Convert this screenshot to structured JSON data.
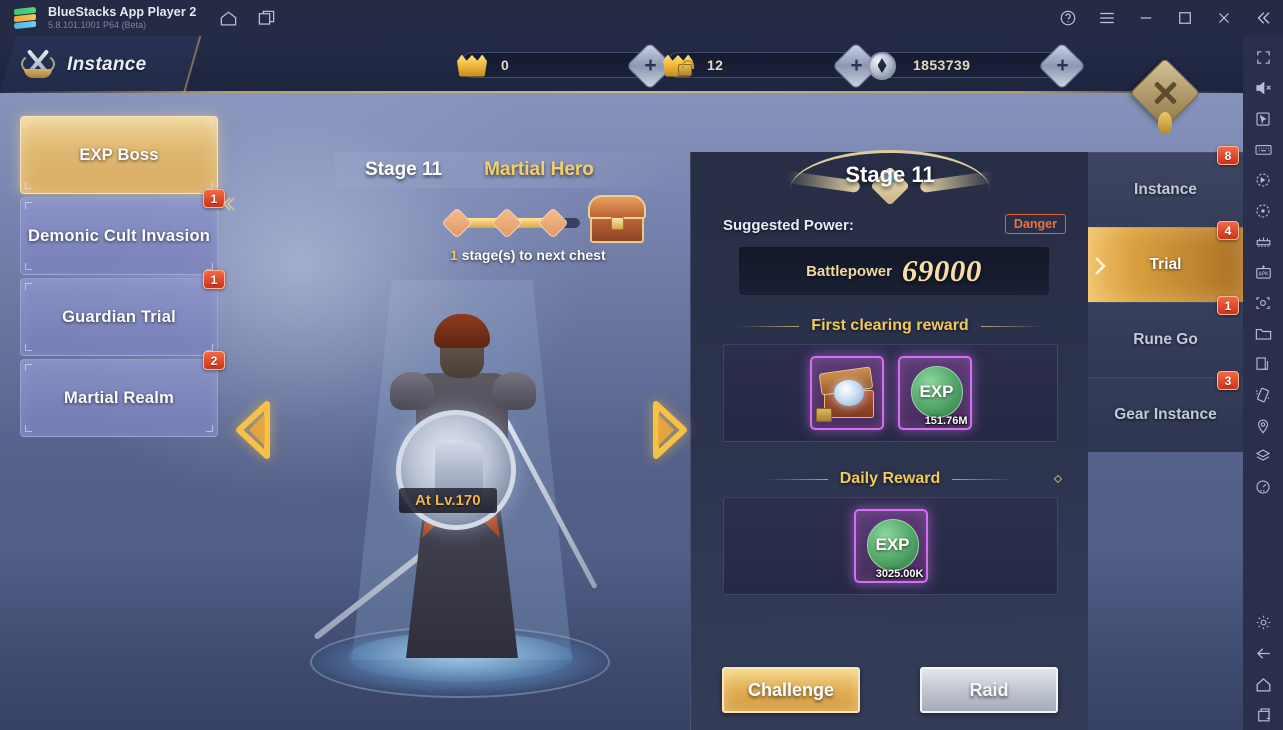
{
  "titlebar": {
    "app_name": "BlueStacks App Player 2",
    "version": "5.8.101.1001 P64 (Beta)",
    "icons": [
      "home-icon",
      "multi-instance-icon"
    ],
    "controls": [
      "help-icon",
      "menu-icon",
      "minimize-icon",
      "maximize-icon",
      "close-icon",
      "collapse-icon"
    ]
  },
  "game": {
    "header": {
      "title": "Instance",
      "currencies": [
        {
          "icon": "gold-ingot-icon",
          "value": "0"
        },
        {
          "icon": "locked-gold-ingot-icon",
          "value": "12"
        },
        {
          "icon": "silver-gem-icon",
          "value": "1853739"
        }
      ],
      "add_label": "+",
      "close_label": "close-diamond-button"
    },
    "left_menu": [
      {
        "label": "EXP Boss",
        "badge": "",
        "selected": true
      },
      {
        "label": "Demonic Cult Invasion",
        "badge": "1",
        "selected": false
      },
      {
        "label": "Guardian Trial",
        "badge": "1",
        "selected": false
      },
      {
        "label": "Martial Realm",
        "badge": "2",
        "selected": false
      }
    ],
    "stage_header": {
      "stage": "Stage 11",
      "rank": "Martial Hero",
      "chest_progress_count": "1",
      "chest_progress_text": "stage(s) to next chest",
      "chest_progress_full": "1 stage(s) to next chest"
    },
    "character": {
      "level_label": "At Lv.170"
    },
    "nav_arrows": {
      "prev": "previous-stage-arrow",
      "next": "next-stage-arrow"
    },
    "panel": {
      "title": "Stage 11",
      "suggested_power_label": "Suggested Power:",
      "danger_label": "Danger",
      "battlepower_label": "Battlepower",
      "battlepower_value": "69000",
      "first_clearing_reward_label": "First clearing reward",
      "first_clearing_rewards": [
        {
          "icon": "treasure-chest-item-icon",
          "qty": ""
        },
        {
          "icon": "exp-orb-icon",
          "label": "EXP",
          "qty": "151.76M"
        }
      ],
      "daily_reward_label": "Daily Reward",
      "daily_rewards": [
        {
          "icon": "exp-orb-icon",
          "label": "EXP",
          "qty": "3025.00K"
        }
      ],
      "buttons": [
        {
          "label": "Challenge",
          "style": "gold"
        },
        {
          "label": "Raid",
          "style": "silver"
        }
      ]
    },
    "right_nav": [
      {
        "label": "Instance",
        "badge": "8",
        "selected": false
      },
      {
        "label": "Trial",
        "badge": "4",
        "selected": true
      },
      {
        "label": "Rune Go",
        "badge": "1",
        "selected": false
      },
      {
        "label": "Gear Instance",
        "badge": "3",
        "selected": false
      }
    ]
  },
  "sidebar": {
    "items": [
      "fullscreen-icon",
      "mute-icon",
      "cursor-icon",
      "keyboard-icon",
      "rotate-left-icon",
      "rotate-right-icon",
      "gamepad-icon",
      "install-apk-icon",
      "screenshot-icon",
      "folder-icon",
      "copy-icon",
      "shake-icon",
      "location-icon",
      "layers-icon",
      "gauge-icon",
      "settings-icon",
      "back-icon",
      "home-icon",
      "recents-icon"
    ]
  },
  "colors": {
    "accent_gold": "#f2ca5c",
    "selected_gold": "#e0b872",
    "badge_red": "#cc3118",
    "danger_red": "#ef7040",
    "panel_bg": "#262c47",
    "titlebar_bg": "#252a45",
    "sidebar_bg": "#2a2f4d",
    "exp_green": "#55a86a",
    "item_purple": "#d36ff0"
  }
}
